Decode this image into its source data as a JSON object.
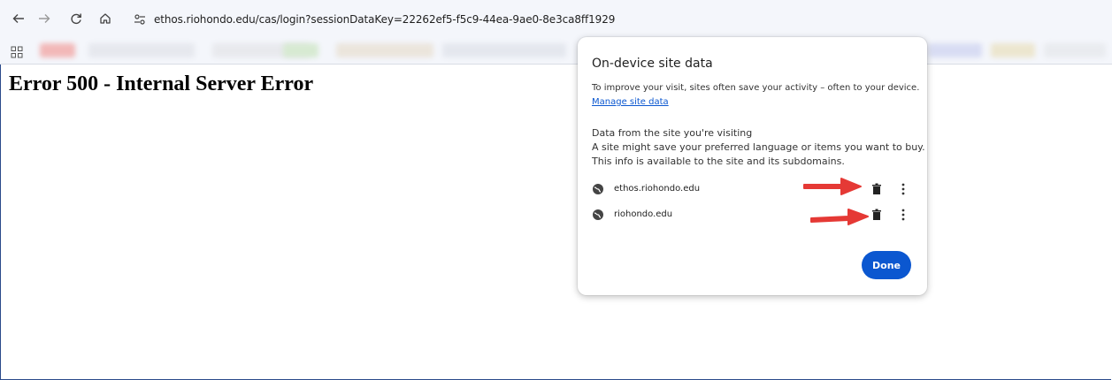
{
  "browser": {
    "url": "ethos.riohondo.edu/cas/login?sessionDataKey=22262ef5-f5c9-44ea-9ae0-8e3ca8ff1929",
    "back_icon": "arrow-left-icon",
    "forward_icon": "arrow-right-icon",
    "reload_icon": "reload-icon",
    "home_icon": "home-icon",
    "site_info_icon": "tune-icon",
    "apps_icon": "apps-grid-icon"
  },
  "page": {
    "heading": "Error 500 - Internal Server Error"
  },
  "popup": {
    "title": "On-device site data",
    "description": "To improve your visit, sites often save your activity – often to your device.",
    "manage_link": "Manage site data",
    "section_heading": "Data from the site you're visiting",
    "section_line1": "A site might save your preferred language or items you want to buy.",
    "section_line2": "This info is available to the site and its subdomains.",
    "sites": [
      {
        "label": "ethos.riohondo.edu"
      },
      {
        "label": "riohondo.edu"
      }
    ],
    "done_label": "Done"
  },
  "colors": {
    "accent": "#0b57d0",
    "annotation_arrow": "#e53935"
  }
}
